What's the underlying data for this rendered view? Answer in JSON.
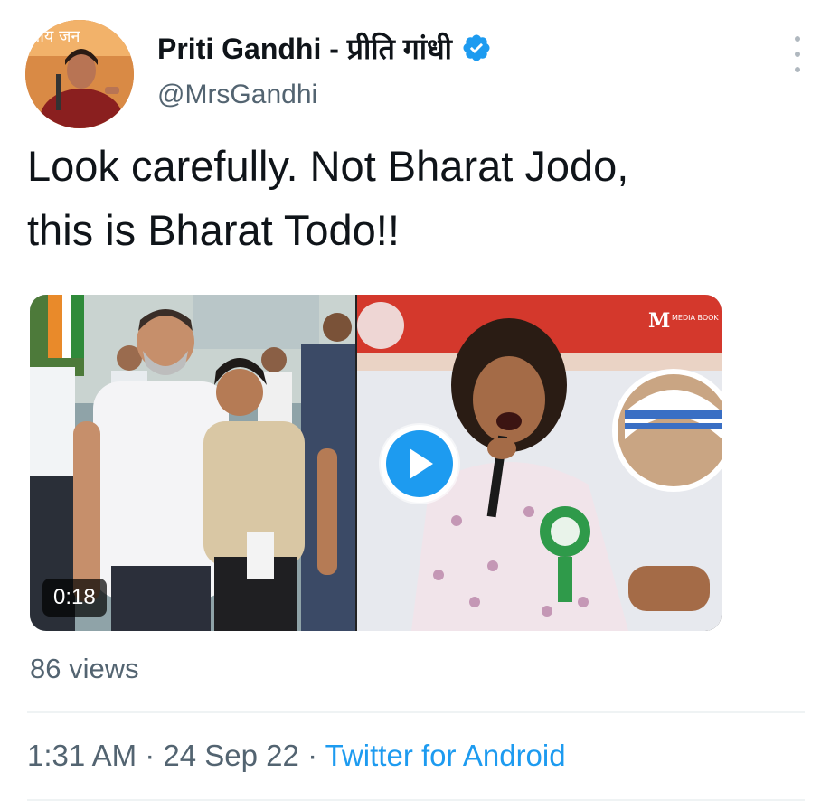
{
  "tweet": {
    "display_name": "Priti Gandhi - प्रीति गांधी",
    "handle": "@MrsGandhi",
    "verified_icon": "verified-badge-icon",
    "more_icon": "more-vertical-icon",
    "text_line1": "Look carefully. Not Bharat Jodo,",
    "text_line2": "this is Bharat Todo!!",
    "avatar_banner_text": "तीय जन",
    "media": {
      "duration": "0:18",
      "watermark": "M",
      "watermark_small": "MEDIA BOOK",
      "play_icon": "play-icon"
    },
    "views": "86 views",
    "time": "1:31 AM",
    "separator": "·",
    "date": "24 Sep 22",
    "source": "Twitter for Android"
  },
  "colors": {
    "accent": "#1d9bf0",
    "text": "#0f1419",
    "secondary": "#536471"
  }
}
